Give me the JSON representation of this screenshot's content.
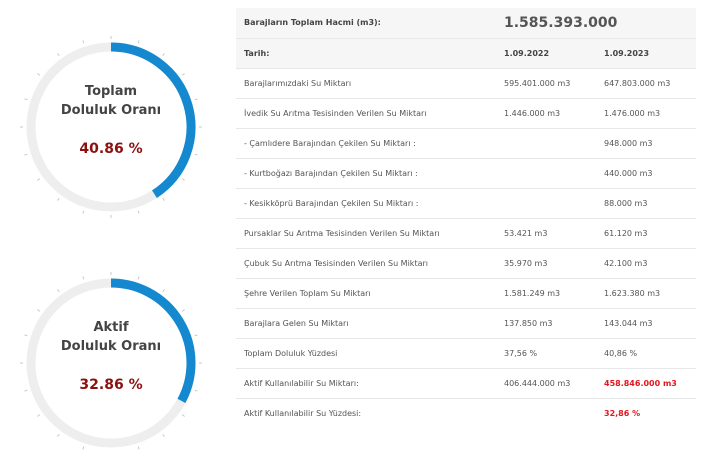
{
  "gauges": [
    {
      "label_line1": "Toplam",
      "label_line2": "Doluluk Oranı",
      "value_text": "40.86 %",
      "fill_percent": 40.86,
      "arc_color": "#1589cf",
      "track_color": "#eeeeee",
      "value_color": "#8b1111"
    },
    {
      "label_line1": "Aktif",
      "label_line2": "Doluluk Oranı",
      "value_text": "32.86 %",
      "fill_percent": 32.86,
      "arc_color": "#1589cf",
      "track_color": "#eeeeee",
      "value_color": "#8b1111"
    }
  ],
  "table": {
    "total_volume_label": "Barajların Toplam Hacmi (m3):",
    "total_volume_value": "1.585.393.000",
    "date_label": "Tarih:",
    "date_1": "1.09.2022",
    "date_2": "1.09.2023",
    "rows": [
      {
        "label": "Barajlarımızdaki Su Miktarı",
        "v1": "595.401.000 m3",
        "v2": "647.803.000 m3"
      },
      {
        "label": "İvedik Su Arıtma Tesisinden Verilen Su Miktarı",
        "v1": "1.446.000 m3",
        "v2": "1.476.000 m3"
      },
      {
        "label": " - Çamlıdere Barajından Çekilen Su Miktarı :",
        "v1": "",
        "v2": "948.000 m3"
      },
      {
        "label": " - Kurtboğazı Barajından Çekilen Su Miktarı :",
        "v1": "",
        "v2": "440.000 m3"
      },
      {
        "label": " - Kesikköprü Barajından Çekilen Su Miktarı :",
        "v1": "",
        "v2": "88.000 m3"
      },
      {
        "label": "Pursaklar Su Arıtma Tesisinden Verilen Su Miktarı",
        "v1": "53.421 m3",
        "v2": "61.120 m3"
      },
      {
        "label": "Çubuk Su Arıtma Tesisinden Verilen Su Miktarı",
        "v1": "35.970 m3",
        "v2": "42.100 m3"
      },
      {
        "label": "Şehre Verilen Toplam Su Miktarı",
        "v1": "1.581.249 m3",
        "v2": "1.623.380 m3"
      },
      {
        "label": "Barajlara Gelen Su Miktarı",
        "v1": "137.850 m3",
        "v2": "143.044 m3"
      },
      {
        "label": "Toplam Doluluk Yüzdesi",
        "v1": "37,56 %",
        "v2": "40,86 %"
      },
      {
        "label": "Aktif Kullanılabilir Su Miktarı:",
        "v1": "406.444.000 m3",
        "v2": "458.846.000 m3",
        "v2_highlight": true
      },
      {
        "label": "Aktif Kullanılabilir Su Yüzdesi:",
        "v1": "",
        "v2": "32,86 %",
        "v2_highlight": true
      }
    ]
  }
}
